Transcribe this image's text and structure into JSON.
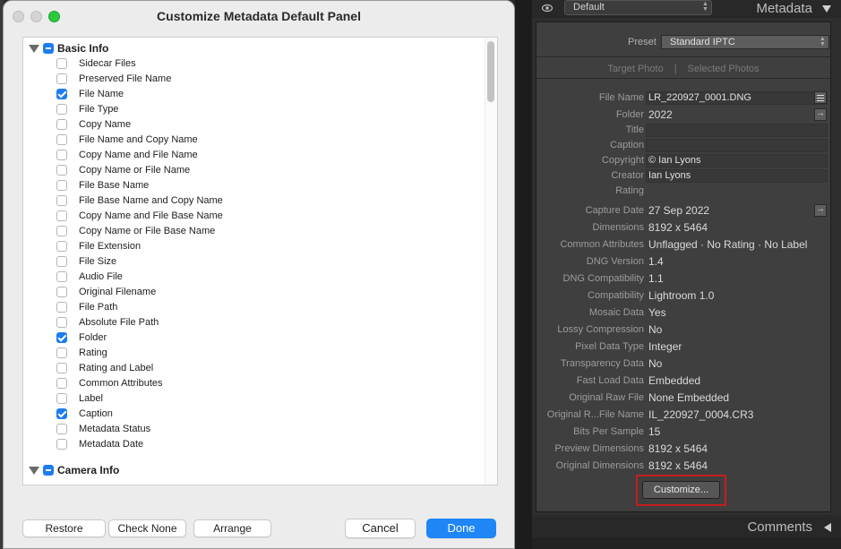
{
  "dialog": {
    "title": "Customize Metadata Default Panel",
    "sections": [
      {
        "label": "Basic Info",
        "items": [
          {
            "label": "Sidecar Files",
            "checked": false
          },
          {
            "label": "Preserved File Name",
            "checked": false
          },
          {
            "label": "File Name",
            "checked": true
          },
          {
            "label": "File Type",
            "checked": false
          },
          {
            "label": "Copy Name",
            "checked": false
          },
          {
            "label": "File Name and Copy Name",
            "checked": false
          },
          {
            "label": "Copy Name and File Name",
            "checked": false
          },
          {
            "label": "Copy Name or File Name",
            "checked": false
          },
          {
            "label": "File Base Name",
            "checked": false
          },
          {
            "label": "File Base Name and Copy Name",
            "checked": false
          },
          {
            "label": "Copy Name and File Base Name",
            "checked": false
          },
          {
            "label": "Copy Name or File Base Name",
            "checked": false
          },
          {
            "label": "File Extension",
            "checked": false
          },
          {
            "label": "File Size",
            "checked": false
          },
          {
            "label": "Audio File",
            "checked": false
          },
          {
            "label": "Original Filename",
            "checked": false
          },
          {
            "label": "File Path",
            "checked": false
          },
          {
            "label": "Absolute File Path",
            "checked": false
          },
          {
            "label": "Folder",
            "checked": true
          },
          {
            "label": "Rating",
            "checked": false
          },
          {
            "label": "Rating and Label",
            "checked": false
          },
          {
            "label": "Common Attributes",
            "checked": false
          },
          {
            "label": "Label",
            "checked": false
          },
          {
            "label": "Caption",
            "checked": true
          },
          {
            "label": "Metadata Status",
            "checked": false
          },
          {
            "label": "Metadata Date",
            "checked": false
          }
        ]
      },
      {
        "label": "Camera Info",
        "items": []
      }
    ],
    "buttons": {
      "restore": "Restore",
      "check_none": "Check None",
      "arrange": "Arrange",
      "cancel": "Cancel",
      "done": "Done"
    }
  },
  "panel": {
    "header_preset": "Default",
    "title": "Metadata",
    "preset_label": "Preset",
    "preset_value": "Standard IPTC",
    "target_photo": "Target Photo",
    "divider": "|",
    "selected_photos": "Selected Photos",
    "fields": [
      {
        "label": "File Name",
        "value": "LR_220927_0001.DNG",
        "kind": "field",
        "action": "lines"
      },
      {
        "label": "Folder",
        "value": "2022",
        "kind": "text",
        "action": "arrow"
      },
      {
        "label": "Title",
        "value": "",
        "kind": "field"
      },
      {
        "label": "Caption",
        "value": "",
        "kind": "field"
      },
      {
        "label": "Copyright",
        "value": "© Ian Lyons",
        "kind": "field"
      },
      {
        "label": "Creator",
        "value": "Ian Lyons",
        "kind": "field"
      },
      {
        "label": "Rating",
        "value": "",
        "kind": "text"
      },
      {
        "label": "Capture Date",
        "value": "27 Sep 2022",
        "kind": "text",
        "action": "arrow"
      },
      {
        "label": "Dimensions",
        "value": "8192 x 5464",
        "kind": "text"
      },
      {
        "label": "Common Attributes",
        "value": "Unflagged  ·  No Rating  ·  No Label",
        "kind": "text"
      },
      {
        "label": "DNG Version",
        "value": "1.4",
        "kind": "text"
      },
      {
        "label": "DNG Compatibility",
        "value": "1.1",
        "kind": "text"
      },
      {
        "label": "Compatibility",
        "value": "Lightroom 1.0",
        "kind": "text"
      },
      {
        "label": "Mosaic Data",
        "value": "Yes",
        "kind": "text"
      },
      {
        "label": "Lossy Compression",
        "value": "No",
        "kind": "text"
      },
      {
        "label": "Pixel Data Type",
        "value": "Integer",
        "kind": "text"
      },
      {
        "label": "Transparency Data",
        "value": "No",
        "kind": "text"
      },
      {
        "label": "Fast Load Data",
        "value": "Embedded",
        "kind": "text"
      },
      {
        "label": "Original Raw File",
        "value": "None Embedded",
        "kind": "text"
      },
      {
        "label": "Original R...File Name",
        "value": "IL_220927_0004.CR3",
        "kind": "text"
      },
      {
        "label": "Bits Per Sample",
        "value": "15",
        "kind": "text"
      },
      {
        "label": "Preview Dimensions",
        "value": "8192 x 5464",
        "kind": "text"
      },
      {
        "label": "Original Dimensions",
        "value": "8192 x 5464",
        "kind": "text"
      }
    ],
    "customize_button": "Customize...",
    "comments_title": "Comments"
  },
  "colors": {
    "accent": "#1e7cf1",
    "highlight_outline": "#c41e1e"
  }
}
